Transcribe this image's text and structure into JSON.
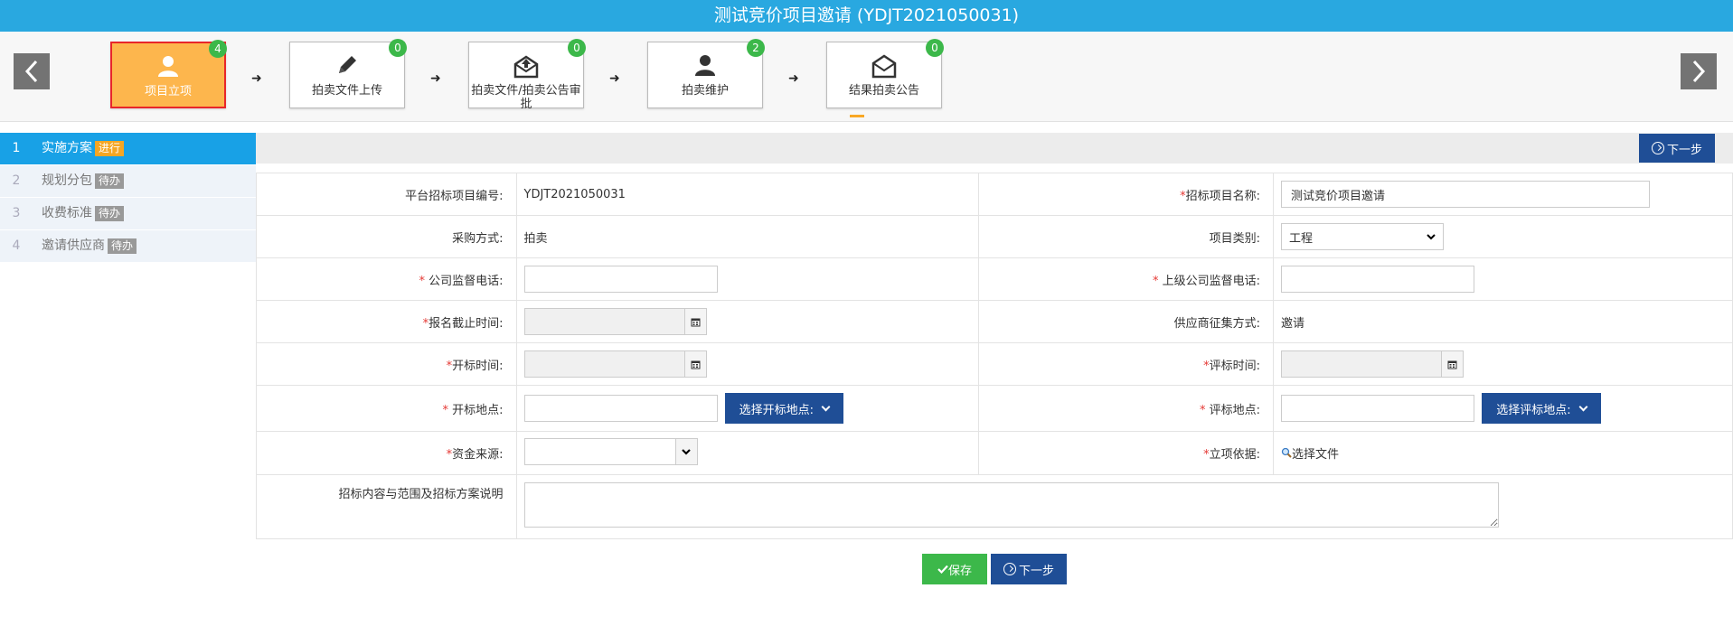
{
  "title": "测试竞价项目邀请 (YDJT2021050031)",
  "steps": [
    {
      "label": "项目立项",
      "badge": "4",
      "icon": "user-icon"
    },
    {
      "label": "拍卖文件上传",
      "badge": "0",
      "icon": "pencil-icon"
    },
    {
      "label": "拍卖文件/拍卖公告审批",
      "badge": "0",
      "icon": "envelope-upload-icon"
    },
    {
      "label": "拍卖维护",
      "badge": "2",
      "icon": "user-icon"
    },
    {
      "label": "结果拍卖公告",
      "badge": "0",
      "icon": "envelope-icon"
    }
  ],
  "menu": [
    {
      "num": "1",
      "label": "实施方案",
      "tag": "进行"
    },
    {
      "num": "2",
      "label": "规划分包",
      "tag": "待办"
    },
    {
      "num": "3",
      "label": "收费标准",
      "tag": "待办"
    },
    {
      "num": "4",
      "label": "邀请供应商",
      "tag": "待办"
    }
  ],
  "buttons": {
    "next": "下一步",
    "save": "保存",
    "pick_open_place": "选择开标地点:",
    "pick_eval_place": "选择评标地点:",
    "choose_file": "选择文件"
  },
  "form": {
    "platform_no_label": "平台招标项目编号:",
    "platform_no_value": "YDJT2021050031",
    "project_name_label": "招标项目名称:",
    "project_name_value": "测试竞价项目邀请",
    "purchase_method_label": "采购方式:",
    "purchase_method_value": "拍卖",
    "project_type_label": "项目类别:",
    "project_type_value": "工程",
    "company_phone_label": "公司监督电话:",
    "parent_phone_label": "上级公司监督电话:",
    "signup_deadline_label": "报名截止时间:",
    "supplier_method_label": "供应商征集方式:",
    "supplier_method_value": "邀请",
    "open_time_label": "开标时间:",
    "eval_time_label": "评标时间:",
    "open_place_label": "开标地点:",
    "eval_place_label": "评标地点:",
    "fund_source_label": "资金来源:",
    "basis_label": "立项依据:",
    "scope_label": "招标内容与范围及招标方案说明",
    "required_mark": "*"
  }
}
